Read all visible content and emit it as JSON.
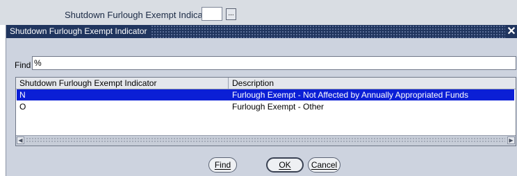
{
  "background": {
    "field_label": "Shutdown Furlough Exempt Indicator",
    "field_value": "",
    "lov_button": "..."
  },
  "dialog": {
    "title": "Shutdown Furlough Exempt Indicator",
    "close_icon": "close-icon",
    "find": {
      "label": "Find",
      "value": "%"
    },
    "table": {
      "columns": [
        "Shutdown Furlough Exempt Indicator",
        "Description"
      ],
      "rows": [
        {
          "code": "N",
          "description": "Furlough Exempt - Not Affected by Annually Appropriated Funds",
          "selected": true
        },
        {
          "code": "O",
          "description": "Furlough Exempt - Other",
          "selected": false
        }
      ]
    },
    "scrollbar": {
      "left_arrow": "◀",
      "right_arrow": "▶"
    },
    "buttons": {
      "find": "Find",
      "ok": "OK",
      "cancel": "Cancel"
    }
  },
  "colors": {
    "titlebar": "#20355e",
    "selection": "#0b1fd6",
    "dialog_bg": "#cdd3df"
  }
}
